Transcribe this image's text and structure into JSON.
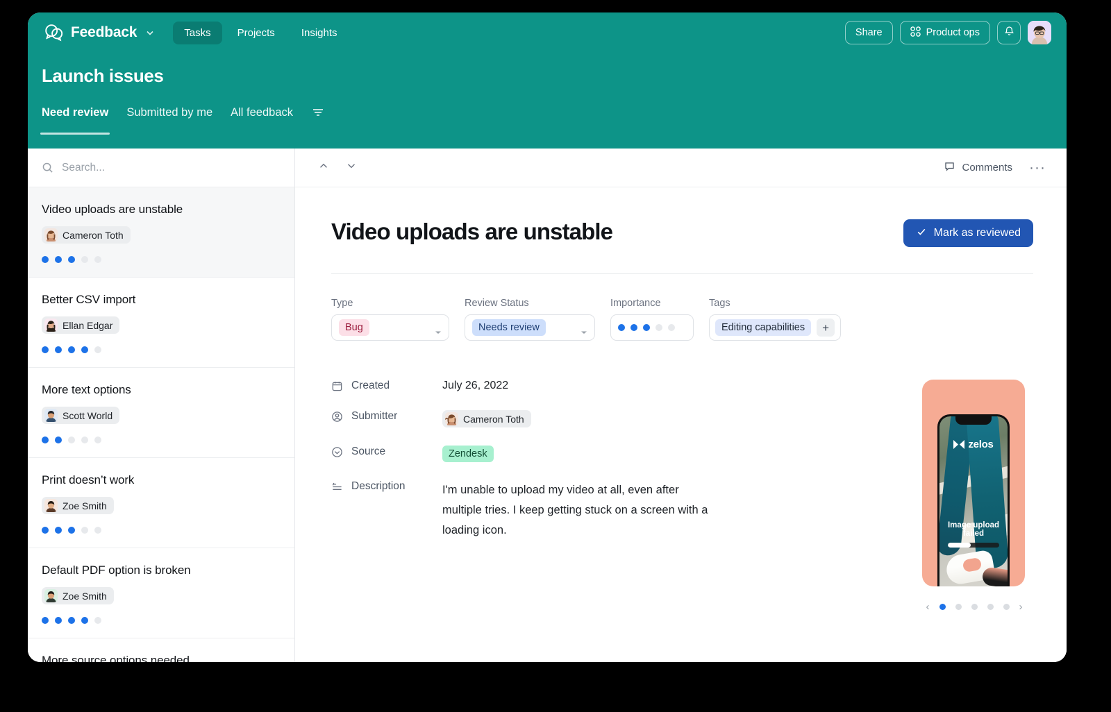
{
  "app": {
    "brand_name": "Feedback",
    "brand_icon": "chat-bubbles-icon",
    "nav_tabs": [
      {
        "label": "Tasks",
        "active": true
      },
      {
        "label": "Projects",
        "active": false
      },
      {
        "label": "Insights",
        "active": false
      }
    ],
    "share_label": "Share",
    "workspace_label": "Product ops",
    "notifications_icon": "bell-icon",
    "avatar_icon": "user-avatar"
  },
  "header": {
    "page_title": "Launch issues",
    "sub_tabs": [
      {
        "label": "Need review",
        "active": true
      },
      {
        "label": "Submitted by me",
        "active": false
      },
      {
        "label": "All feedback",
        "active": false
      }
    ],
    "filter_icon": "filter-icon"
  },
  "sidebar": {
    "search": {
      "placeholder": "Search...",
      "value": ""
    },
    "tasks": [
      {
        "title": "Video uploads are unstable",
        "author": "Cameron Toth",
        "importance_filled": 3,
        "importance_total": 5,
        "selected": true
      },
      {
        "title": "Better CSV import",
        "author": "Ellan Edgar",
        "importance_filled": 4,
        "importance_total": 5,
        "selected": false
      },
      {
        "title": "More text options",
        "author": "Scott World",
        "importance_filled": 2,
        "importance_total": 5,
        "selected": false
      },
      {
        "title": "Print doesn’t work",
        "author": "Zoe Smith",
        "importance_filled": 3,
        "importance_total": 5,
        "selected": false
      },
      {
        "title": "Default PDF option is broken",
        "author": "Zoe Smith",
        "importance_filled": 4,
        "importance_total": 5,
        "selected": false
      },
      {
        "title": "More source options needed",
        "author": "",
        "importance_filled": 0,
        "importance_total": 0,
        "selected": false
      }
    ]
  },
  "detail": {
    "prev_icon": "chevron-up-icon",
    "next_icon": "chevron-down-icon",
    "comments_label": "Comments",
    "more_label": "···",
    "issue_title": "Video uploads are unstable",
    "review_button": "Mark as reviewed",
    "properties": {
      "type": {
        "label": "Type",
        "value": "Bug"
      },
      "review_status": {
        "label": "Review Status",
        "value": "Needs review"
      },
      "importance": {
        "label": "Importance",
        "filled": 3,
        "total": 5
      },
      "tags": {
        "label": "Tags",
        "values": [
          "Editing capabilities"
        ],
        "add_label": "+"
      }
    },
    "meta": [
      {
        "icon": "calendar-icon",
        "label": "Created",
        "value": "July 26, 2022",
        "kind": "text"
      },
      {
        "icon": "user-circle-icon",
        "label": "Submitter",
        "value": "Cameron Toth",
        "kind": "person"
      },
      {
        "icon": "check-circle-icon",
        "label": "Source",
        "value": "Zendesk",
        "kind": "tag"
      },
      {
        "icon": "description-icon",
        "label": "Description",
        "value": "I'm unable to upload my video at all, even after multiple tries. I keep getting stuck on a screen with a loading icon.",
        "kind": "paragraph"
      }
    ],
    "attachment": {
      "brand": "zelos",
      "status_text": "Image upload failed",
      "progress_percent": 45,
      "carousel": {
        "count": 5,
        "active_index": 0,
        "prev_icon": "chevron-left-icon",
        "next_icon": "chevron-right-icon"
      }
    }
  },
  "colors": {
    "brand_teal": "#0d9488",
    "accent_blue": "#1d72e8",
    "button_blue": "#2256b3",
    "tag_bug_bg": "#fcdfe7",
    "tag_needs_bg": "#cddefb",
    "tag_zendesk_bg": "#a7f0cf",
    "card_salmon": "#f6ab94"
  }
}
